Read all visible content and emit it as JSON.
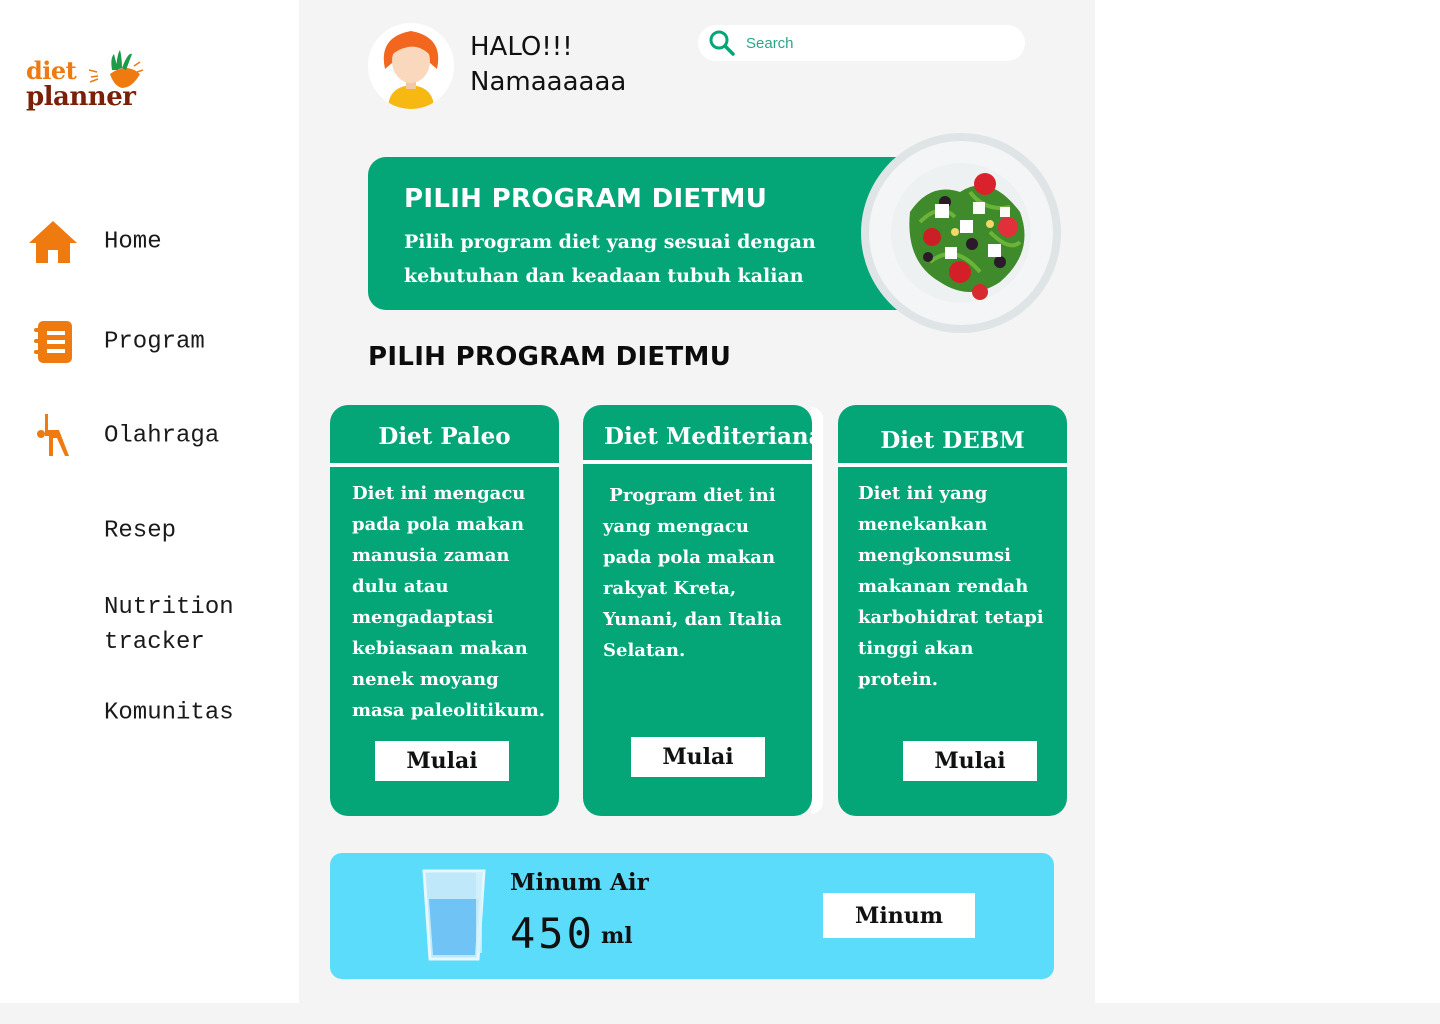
{
  "logo": {
    "line1": "diet",
    "line2": "planner"
  },
  "colors": {
    "accent": "#04a678",
    "orange": "#ee7a10",
    "water": "#5cdcfb",
    "brand_dark": "#7a1f08"
  },
  "sidebar": {
    "items": [
      {
        "label": "Home",
        "icon": "home-icon"
      },
      {
        "label": "Program",
        "icon": "notebook-icon"
      },
      {
        "label": "Olahraga",
        "icon": "exercise-icon"
      },
      {
        "label": "Resep",
        "icon": ""
      },
      {
        "label": "Nutrition tracker",
        "icon": ""
      },
      {
        "label": "Komunitas",
        "icon": ""
      }
    ]
  },
  "header": {
    "greeting": "HALO!!!",
    "username": "Namaaaaaa",
    "search_placeholder": "Search"
  },
  "banner": {
    "title": "PILIH PROGRAM DIETMU",
    "description": "Pilih program diet yang sesuai dengan kebutuhan dan keadaan tubuh kalian"
  },
  "section_title": "PILIH PROGRAM DIETMU",
  "programs": [
    {
      "title": "Diet Paleo",
      "description": "Diet ini mengacu pada pola makan manusia zaman dulu atau mengadaptasi kebiasaan makan nenek moyang masa paleolitikum.",
      "button": "Mulai"
    },
    {
      "title": "Diet Mediteriana",
      "description": " Program diet ini yang mengacu pada pola makan rakyat Kreta, Yunani, dan Italia Selatan.",
      "button": "Mulai"
    },
    {
      "title": "Diet DEBM",
      "description": "Diet ini yang menekankan mengkonsumsi makanan rendah karbohidrat tetapi tinggi akan protein.",
      "button": "Mulai"
    }
  ],
  "water": {
    "title": "Minum Air",
    "amount": "450",
    "unit": "ml",
    "button": "Minum"
  }
}
